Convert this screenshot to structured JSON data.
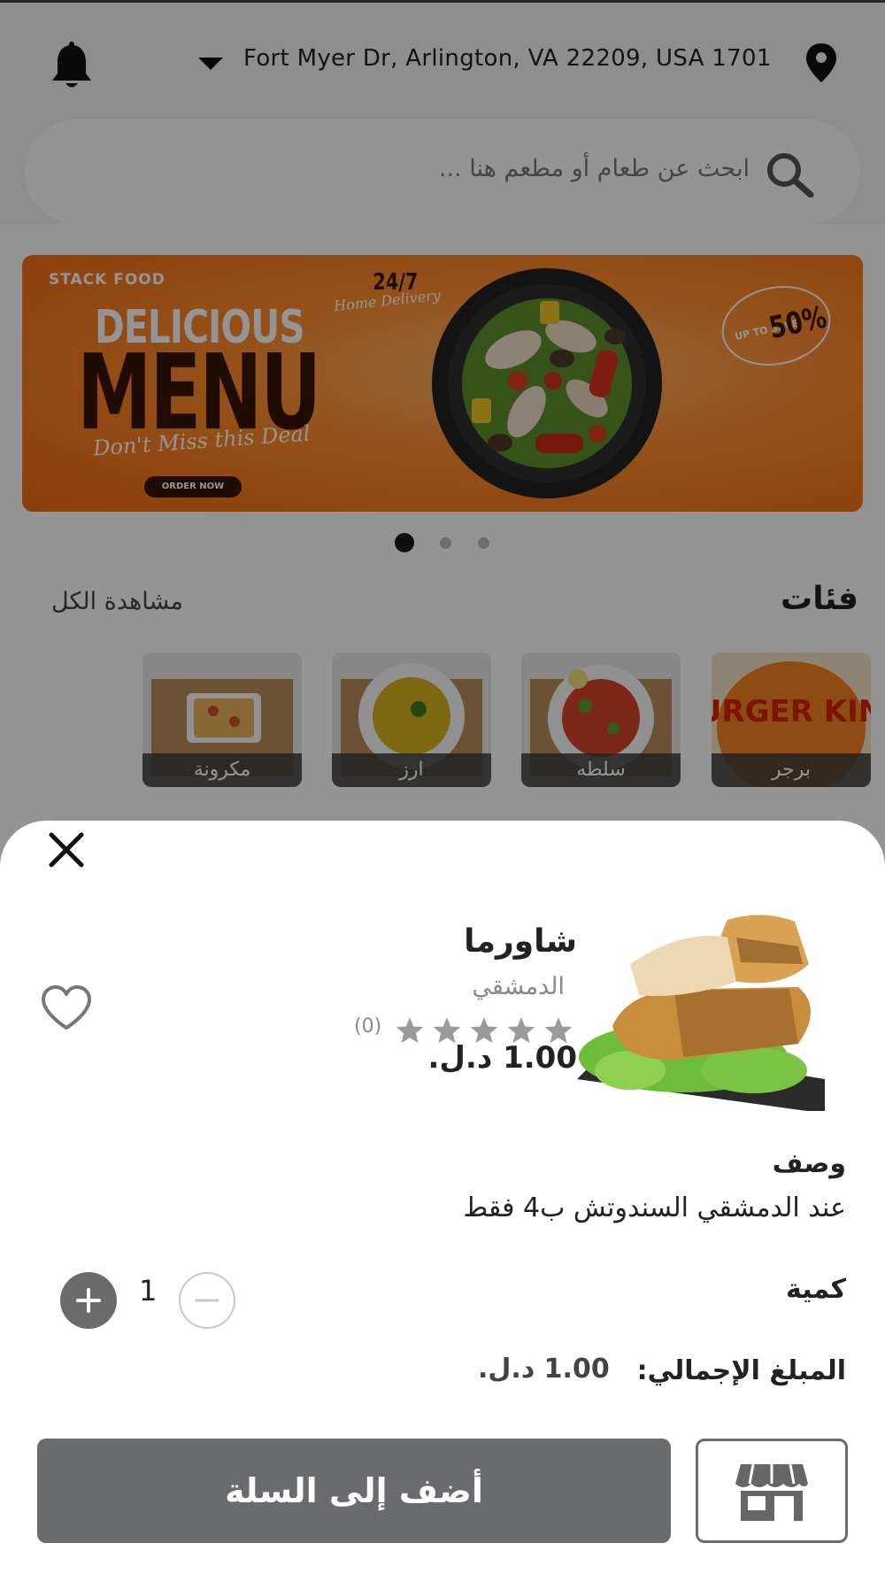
{
  "header": {
    "address": "Fort Myer Dr, Arlington, VA 22209, USA 1701"
  },
  "search": {
    "placeholder": "ابحث عن طعام أو مطعم هنا ..."
  },
  "banner": {
    "logo": "STACK FOOD",
    "headline_1": "DELICIOUS",
    "headline_2": "MENU",
    "tagline": "Don't Miss this Deal",
    "cta": "ORDER NOW",
    "delivery_big": "24/7",
    "delivery_small": "Home Delivery",
    "offer_small": "UP TO SAVE",
    "offer_big": "50%",
    "slides": 3,
    "active_slide": 1
  },
  "categories": {
    "title": "فئات",
    "view_all": "مشاهدة الكل",
    "items": [
      {
        "label": "برجر",
        "logo_text": "BURGER KING"
      },
      {
        "label": "سلطه"
      },
      {
        "label": "ارز"
      },
      {
        "label": "مكرونة"
      }
    ]
  },
  "sheet": {
    "food_name": "شاورما",
    "restaurant": "الدمشقي",
    "rating": 0,
    "rating_count": "(0)",
    "price": "1.00 د.ل.",
    "description_title": "وصف",
    "description": "عند الدمشقي السندوتش ب4 فقط",
    "quantity_label": "كمية",
    "quantity": "1",
    "total_label": "المبلغ الإجمالي:",
    "total_value": "1.00 د.ل.",
    "add_to_cart": "أضف إلى السلة"
  },
  "icons": {
    "notification": "bell-icon",
    "location": "map-pin-icon",
    "search": "search-icon",
    "close": "close-icon",
    "favorite": "heart-icon",
    "store": "store-icon"
  },
  "colors": {
    "banner_orange": "#ff8a2a",
    "banner_dark": "#3a1608",
    "button_gray": "#6a6b6e",
    "star_gray": "#9a9a9a"
  }
}
